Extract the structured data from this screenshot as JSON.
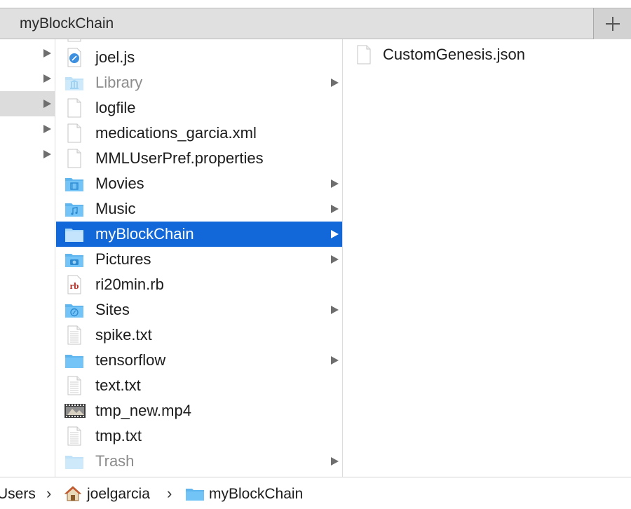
{
  "window": {
    "tab_title": "myBlockChain"
  },
  "columns": {
    "col2_items": [
      {
        "label": "joel.js",
        "icon": "javascript-file-icon",
        "folder": false,
        "dim": false,
        "selected": false
      },
      {
        "label": "Library",
        "icon": "library-folder-icon",
        "folder": true,
        "dim": true,
        "selected": false
      },
      {
        "label": "logfile",
        "icon": "document-icon",
        "folder": false,
        "dim": false,
        "selected": false
      },
      {
        "label": "medications_garcia.xml",
        "icon": "document-icon",
        "folder": false,
        "dim": false,
        "selected": false
      },
      {
        "label": "MMLUserPref.properties",
        "icon": "document-icon",
        "folder": false,
        "dim": false,
        "selected": false
      },
      {
        "label": "Movies",
        "icon": "movies-folder-icon",
        "folder": true,
        "dim": false,
        "selected": false
      },
      {
        "label": "Music",
        "icon": "music-folder-icon",
        "folder": true,
        "dim": false,
        "selected": false
      },
      {
        "label": "myBlockChain",
        "icon": "folder-icon",
        "folder": true,
        "dim": false,
        "selected": true
      },
      {
        "label": "Pictures",
        "icon": "pictures-folder-icon",
        "folder": true,
        "dim": false,
        "selected": false
      },
      {
        "label": "ri20min.rb",
        "icon": "ruby-file-icon",
        "folder": false,
        "dim": false,
        "selected": false
      },
      {
        "label": "Sites",
        "icon": "sites-folder-icon",
        "folder": true,
        "dim": false,
        "selected": false
      },
      {
        "label": "spike.txt",
        "icon": "text-file-icon",
        "folder": false,
        "dim": false,
        "selected": false
      },
      {
        "label": "tensorflow",
        "icon": "folder-icon",
        "folder": true,
        "dim": false,
        "selected": false
      },
      {
        "label": "text.txt",
        "icon": "text-file-icon",
        "folder": false,
        "dim": false,
        "selected": false
      },
      {
        "label": "tmp_new.mp4",
        "icon": "video-thumbnail-icon",
        "folder": false,
        "dim": false,
        "selected": false
      },
      {
        "label": "tmp.txt",
        "icon": "text-file-icon",
        "folder": false,
        "dim": false,
        "selected": false
      },
      {
        "label": "Trash",
        "icon": "trash-folder-icon",
        "folder": true,
        "dim": true,
        "selected": false
      }
    ],
    "col3_items": [
      {
        "label": "CustomGenesis.json",
        "icon": "document-icon"
      }
    ]
  },
  "pathbar": {
    "items": [
      {
        "label": "Users"
      },
      {
        "label": "joelgarcia",
        "icon": "home-icon"
      },
      {
        "label": "myBlockChain",
        "icon": "folder-icon"
      }
    ],
    "separator": "›"
  },
  "colors": {
    "selection": "#1268d8",
    "folder_blue": "#5fb6ef",
    "tabbar": "#e0e0e0"
  },
  "ruby_badge": "rb"
}
